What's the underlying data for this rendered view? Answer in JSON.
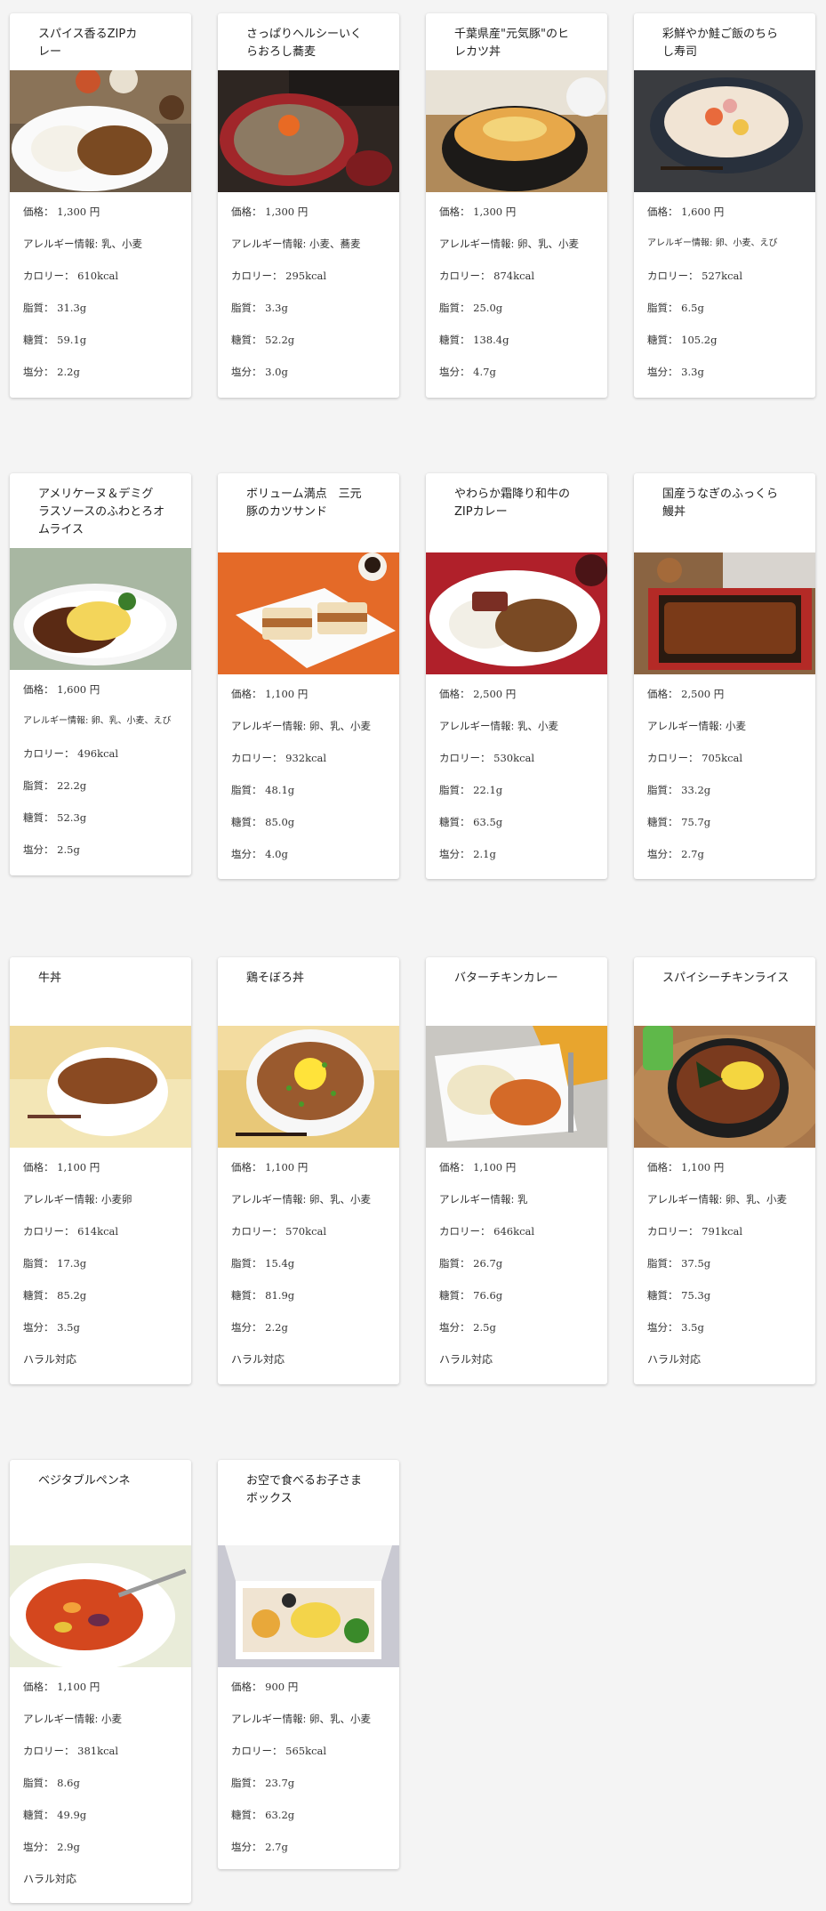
{
  "labels": {
    "price": "価格：",
    "allergy": "アレルギー情報:",
    "calorie": "カロリー：",
    "fat": "脂質：",
    "sugar": "糖質：",
    "salt": "塩分："
  },
  "menu": [
    {
      "name": "スパイス香るZIPカレー",
      "title": "スパイス香るZIPカ\nレー",
      "price": "1,300 円",
      "allergy": "乳、小麦",
      "calorie": "610kcal",
      "fat": "31.3g",
      "sugar": "59.1g",
      "salt": "2.2g",
      "halal": "",
      "image_icon": "curry-plate-image"
    },
    {
      "name": "さっぱりヘルシーいくらおろし蕎麦",
      "title": "さっぱりヘルシーいく\nらおろし蕎麦",
      "price": "1,300 円",
      "allergy": "小麦、蕎麦",
      "calorie": "295kcal",
      "fat": "3.3g",
      "sugar": "52.2g",
      "salt": "3.0g",
      "halal": "",
      "image_icon": "soba-image"
    },
    {
      "name": "千葉県産\"元気豚\"のヒレカツ丼",
      "title": "千葉県産\"元気豚\"のヒ\nレカツ丼",
      "price": "1,300 円",
      "allergy": "卵、乳、小麦",
      "calorie": "874kcal",
      "fat": "25.0g",
      "sugar": "138.4g",
      "salt": "4.7g",
      "halal": "",
      "image_icon": "katsudon-image"
    },
    {
      "name": "彩鮮やか鮭ご飯のちらし寿司",
      "title": "彩鮮やか鮭ご飯のちら\nし寿司",
      "price": "1,600 円",
      "allergy": "卵、小麦、えび",
      "calorie": "527kcal",
      "fat": "6.5g",
      "sugar": "105.2g",
      "salt": "3.3g",
      "halal": "",
      "image_icon": "chirashi-image"
    },
    {
      "name": "アメリケーヌ＆デミグラスソースのふわとろオムライス",
      "title": "アメリケーヌ＆デミグ\nラスソースのふわとろオ\nムライス",
      "price": "1,600 円",
      "allergy": "卵、乳、小麦、えび",
      "calorie": "496kcal",
      "fat": "22.2g",
      "sugar": "52.3g",
      "salt": "2.5g",
      "halal": "",
      "image_icon": "omurice-image"
    },
    {
      "name": "ボリューム満点 三元豚のカツサンド",
      "title": "ボリューム満点　三元\n豚のカツサンド",
      "price": "1,100 円",
      "allergy": "卵、乳、小麦",
      "calorie": "932kcal",
      "fat": "48.1g",
      "sugar": "85.0g",
      "salt": "4.0g",
      "halal": "",
      "image_icon": "katsu-sandwich-image"
    },
    {
      "name": "やわらか霜降り和牛のZIPカレー",
      "title": "やわらか霜降り和牛の\nZIPカレー",
      "price": "2,500 円",
      "allergy": "乳、小麦",
      "calorie": "530kcal",
      "fat": "22.1g",
      "sugar": "63.5g",
      "salt": "2.1g",
      "halal": "",
      "image_icon": "wagyu-curry-image"
    },
    {
      "name": "国産うなぎのふっくら鰻丼",
      "title": "国産うなぎのふっくら\n鰻丼",
      "price": "2,500 円",
      "allergy": "小麦",
      "calorie": "705kcal",
      "fat": "33.2g",
      "sugar": "75.7g",
      "salt": "2.7g",
      "halal": "",
      "image_icon": "unadon-image"
    },
    {
      "name": "牛丼",
      "title": "牛丼",
      "price": "1,100 円",
      "allergy": "小麦卵",
      "calorie": "614kcal",
      "fat": "17.3g",
      "sugar": "85.2g",
      "salt": "3.5g",
      "halal": "ハラル対応",
      "image_icon": "gyudon-image"
    },
    {
      "name": "鶏そぼろ丼",
      "title": "鶏そぼろ丼",
      "price": "1,100 円",
      "allergy": "卵、乳、小麦",
      "calorie": "570kcal",
      "fat": "15.4g",
      "sugar": "81.9g",
      "salt": "2.2g",
      "halal": "ハラル対応",
      "image_icon": "soboro-don-image"
    },
    {
      "name": "バターチキンカレー",
      "title": "バターチキンカレー",
      "price": "1,100 円",
      "allergy": "乳",
      "calorie": "646kcal",
      "fat": "26.7g",
      "sugar": "76.6g",
      "salt": "2.5g",
      "halal": "ハラル対応",
      "image_icon": "butter-chicken-image"
    },
    {
      "name": "スパイシーチキンライス",
      "title": "スパイシーチキンライス",
      "price": "1,100 円",
      "allergy": "卵、乳、小麦",
      "calorie": "791kcal",
      "fat": "37.5g",
      "sugar": "75.3g",
      "salt": "3.5g",
      "halal": "ハラル対応",
      "image_icon": "spicy-chicken-rice-image"
    },
    {
      "name": "ベジタブルペンネ",
      "title": "ベジタブルペンネ",
      "price": "1,100 円",
      "allergy": "小麦",
      "calorie": "381kcal",
      "fat": "8.6g",
      "sugar": "49.9g",
      "salt": "2.9g",
      "halal": "ハラル対応",
      "image_icon": "penne-image"
    },
    {
      "name": "お空で食べるお子さまボックス",
      "title": "お空で食べるお子さま\nボックス",
      "price": "900 円",
      "allergy": "卵、乳、小麦",
      "calorie": "565kcal",
      "fat": "23.7g",
      "sugar": "63.2g",
      "salt": "2.7g",
      "halal": "",
      "image_icon": "kids-box-image"
    }
  ]
}
